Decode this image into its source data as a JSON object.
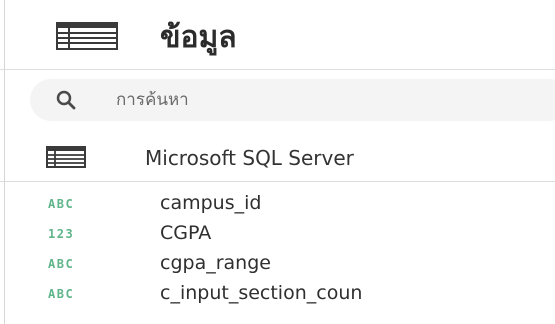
{
  "header": {
    "title": "ข้อมูล",
    "icon": "table-icon"
  },
  "search": {
    "placeholder": "การค้นหา",
    "value": "",
    "icon": "search-icon"
  },
  "source": {
    "label": "Microsoft SQL Server",
    "icon": "database-table-icon"
  },
  "fields": [
    {
      "type": "ABC",
      "name": "campus_id"
    },
    {
      "type": "123",
      "name": "CGPA"
    },
    {
      "type": "ABC",
      "name": "cgpa_range"
    },
    {
      "type": "ABC",
      "name": "c_input_section_coun"
    }
  ],
  "colors": {
    "type_badge": "#5fb58a",
    "text": "#2f2f2f",
    "search_bg": "#f4f4f4",
    "icon_fill": "#3a3a3a"
  }
}
